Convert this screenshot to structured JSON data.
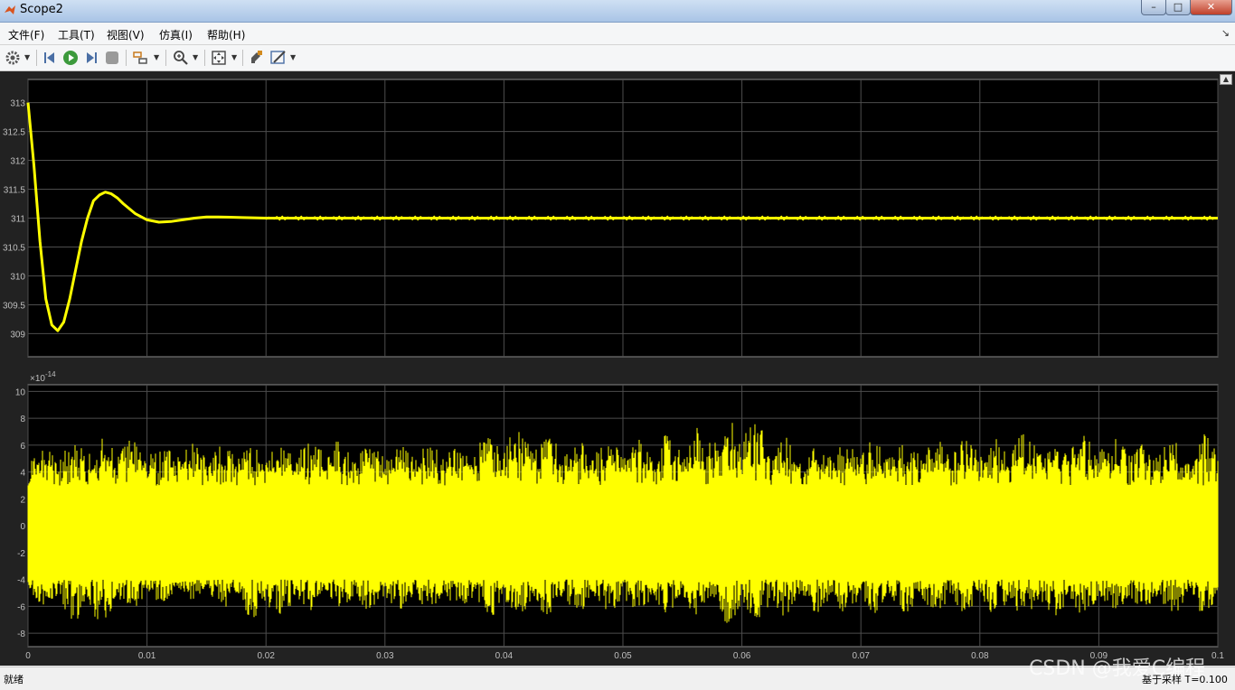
{
  "window": {
    "title": "Scope2",
    "buttons": {
      "minimize": "–",
      "maximize": "□",
      "close": "✕"
    }
  },
  "menu": {
    "items": [
      "文件(F)",
      "工具(T)",
      "视图(V)",
      "仿真(I)",
      "帮助(H)"
    ],
    "overflow_arrow": "↘"
  },
  "toolbar": {
    "icons": [
      "gear-icon",
      "step-back-icon",
      "run-icon",
      "step-forward-icon",
      "stop-icon",
      "signal-selector-icon",
      "zoom-in-icon",
      "autoscale-icon",
      "highlight-icon",
      "style-icon"
    ]
  },
  "status": {
    "left": "就绪",
    "right": "基于采样   T=0.100"
  },
  "watermark": "CSDN @我爱C编程",
  "colors": {
    "plot_bg": "#000000",
    "figure_bg": "#222222",
    "trace": "#ffff00",
    "grid": "#4d4d4d",
    "axis_text": "#bfbfbf"
  },
  "chart_data": [
    {
      "type": "line",
      "title": "",
      "xlabel": "",
      "ylabel": "",
      "xlim": [
        0,
        0.1
      ],
      "ylim": [
        308.6,
        313.4
      ],
      "yticks": [
        "313",
        "312.5",
        "312",
        "311.5",
        "311",
        "310.5",
        "310",
        "309.5",
        "309"
      ],
      "ytick_values": [
        313,
        312.5,
        312,
        311.5,
        311,
        310.5,
        310,
        309.5,
        309
      ],
      "grid": true,
      "series": [
        {
          "x": [
            0,
            0.0005,
            0.001,
            0.0015,
            0.002,
            0.0025,
            0.003,
            0.0035,
            0.004,
            0.0045,
            0.005,
            0.0055,
            0.006,
            0.0065,
            0.007,
            0.0075,
            0.008,
            0.009,
            0.01,
            0.011,
            0.012,
            0.013,
            0.014,
            0.015,
            0.016,
            0.018,
            0.02,
            0.025,
            0.03,
            0.04,
            0.05,
            0.06,
            0.07,
            0.08,
            0.09,
            0.1
          ],
          "values": [
            313.0,
            311.9,
            310.6,
            309.6,
            309.15,
            309.05,
            309.2,
            309.6,
            310.1,
            310.6,
            311.0,
            311.3,
            311.4,
            311.45,
            311.42,
            311.35,
            311.25,
            311.08,
            310.97,
            310.93,
            310.94,
            310.97,
            311.0,
            311.02,
            311.02,
            311.01,
            311.0,
            311.0,
            311.0,
            311.0,
            311.0,
            311.0,
            311.0,
            311.0,
            311.0,
            311.0
          ]
        }
      ]
    },
    {
      "type": "line",
      "title": "",
      "xlabel": "",
      "ylabel": "",
      "exponent_label": "×10",
      "exponent_value": "-14",
      "xlim": [
        0,
        0.1
      ],
      "ylim": [
        -9,
        10.5
      ],
      "xticks": [
        "0",
        "0.01",
        "0.02",
        "0.03",
        "0.04",
        "0.05",
        "0.06",
        "0.07",
        "0.08",
        "0.09",
        "0.1"
      ],
      "xtick_values": [
        0,
        0.01,
        0.02,
        0.03,
        0.04,
        0.05,
        0.06,
        0.07,
        0.08,
        0.09,
        0.1
      ],
      "yticks": [
        "10",
        "8",
        "6",
        "4",
        "2",
        "0",
        "-2",
        "-4",
        "-6",
        "-8"
      ],
      "ytick_values": [
        10,
        8,
        6,
        4,
        2,
        0,
        -2,
        -4,
        -6,
        -8
      ],
      "grid": true,
      "series": [
        {
          "description_x": "numerical noise around zero",
          "envelope_x": [
            0,
            0.005,
            0.01,
            0.015,
            0.02,
            0.025,
            0.03,
            0.035,
            0.04,
            0.045,
            0.05,
            0.055,
            0.06,
            0.065,
            0.07,
            0.075,
            0.08,
            0.085,
            0.09,
            0.095,
            0.1
          ],
          "envelope_max": [
            5.5,
            6.5,
            6.5,
            6.0,
            6.0,
            6.5,
            6.0,
            6.0,
            7.5,
            6.5,
            6.5,
            7.0,
            8.5,
            6.0,
            6.5,
            6.5,
            6.5,
            7.0,
            7.0,
            6.5,
            7.0
          ],
          "envelope_min": [
            -5.5,
            -7.5,
            -6.0,
            -5.5,
            -7.5,
            -6.0,
            -6.5,
            -6.0,
            -7.0,
            -6.5,
            -6.5,
            -6.5,
            -7.5,
            -6.5,
            -6.5,
            -6.5,
            -6.5,
            -7.0,
            -6.5,
            -6.5,
            -6.5
          ]
        }
      ]
    }
  ]
}
